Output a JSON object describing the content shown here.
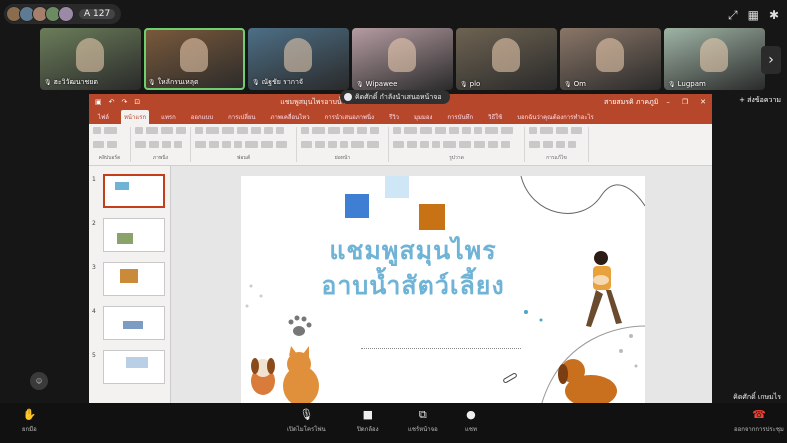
{
  "header": {
    "participant_count": "A 127"
  },
  "participants": [
    {
      "name": "ฮะวิวัฒนาชยต",
      "bg": "#6b7d5a",
      "active": false
    },
    {
      "name": "ใหลักรนเหลุต",
      "bg": "#7b5a3c",
      "active": true
    },
    {
      "name": "ณัฐชัย รากาจั",
      "bg": "#4d6f86",
      "active": false
    },
    {
      "name": "Wipawee",
      "bg": "#b59ca2",
      "active": false
    },
    {
      "name": "plo",
      "bg": "#6e6352",
      "active": false
    },
    {
      "name": "Om",
      "bg": "#8a7668",
      "active": false
    },
    {
      "name": "Lugpam",
      "bg": "#9fb4a5",
      "active": false
    }
  ],
  "share_banner": "คิดศักดิ์ กำลังนำเสนอหน้าจอ",
  "send_message": "+ ส่งข้อความ",
  "powerpoint": {
    "doc_name": "แชมพูสมุนไพรอาบน้ำสัตว์เลี้ยง",
    "user_name": "สายสมรคิ ภาคภูมิ",
    "tabs": [
      "ไฟล์",
      "หน้าแรก",
      "แทรก",
      "ออกแบบ",
      "การเปลี่ยน",
      "ภาพเคลื่อนไหว",
      "การนำเสนอภาพนิ่ง",
      "รีวิว",
      "มุมมอง",
      "การบันทึก",
      "วิธีใช้",
      "บอกฉันว่าคุณต้องการทำอะไร"
    ],
    "active_tab": 1,
    "ribbon_groups": [
      "คลิปบอร์ด",
      "ภาพนิ่ง",
      "ฟอนต์",
      "ย่อหน้า",
      "รูปวาด",
      "การแก้ไข"
    ],
    "slide_numbers": [
      "1",
      "2",
      "3",
      "4",
      "5"
    ],
    "slide": {
      "title_line1": "แชมพูสมุนไพร",
      "title_line2": "อาบน้ำสัตว์เลี้ยง"
    }
  },
  "presenter": "คิดศักดิ์ เกษมไร",
  "controls": {
    "raise_hand": "ยกมือ",
    "mic": "เปิดไมโครโฟน",
    "camera": "ปิดกล้อง",
    "share": "แชร์หน้าจอ",
    "chat": "แชท",
    "leave": "ออกจากการประชุม"
  },
  "colors": {
    "ppt_accent": "#b7472a",
    "slide_title": "#6fb3d6",
    "leave_red": "#ea4335"
  }
}
